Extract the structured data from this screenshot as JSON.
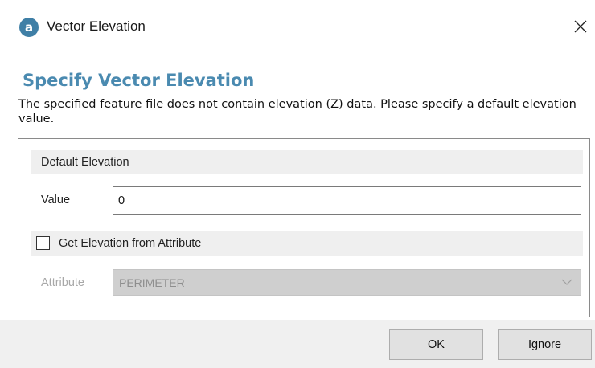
{
  "window": {
    "title": "Vector Elevation",
    "app_icon": "app-logo-icon",
    "close_icon": "close-icon"
  },
  "header": {
    "heading": "Specify Vector Elevation",
    "description": "The specified feature file does not contain elevation (Z) data. Please specify a default elevation value."
  },
  "default_elevation": {
    "section_label": "Default Elevation",
    "value_label": "Value",
    "value": "0"
  },
  "attribute_section": {
    "checkbox_label": "Get Elevation from Attribute",
    "checked": false,
    "attribute_label": "Attribute",
    "selected_attribute": "PERIMETER",
    "enabled": false
  },
  "buttons": {
    "ok": "OK",
    "ignore": "Ignore"
  },
  "colors": {
    "accent": "#4a8ab0",
    "icon_blue": "#3f7fa6",
    "footer_bg": "#f0f0f0",
    "disabled_text": "#a8a8a8"
  }
}
